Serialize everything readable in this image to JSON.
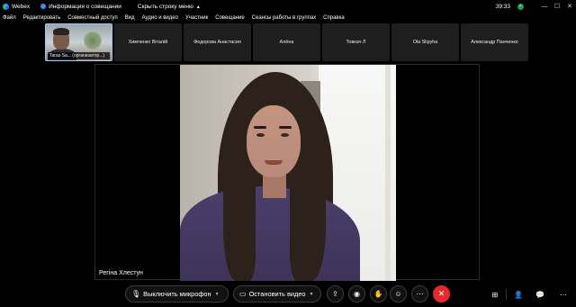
{
  "titlebar": {
    "app_name": "Webex",
    "meeting_info": "Информация о совещании",
    "hide_menu": "Скрыть строку меню",
    "time": "39:33"
  },
  "menu": [
    "Файл",
    "Редактировать",
    "Совместный доступ",
    "Вид",
    "Аудио и видео",
    "Участник",
    "Совещание",
    "Сеансы работы в группах",
    "Справка"
  ],
  "participants": [
    {
      "label": "Taras Sa... (организатор...)",
      "active": true
    },
    {
      "label": "Химченко Віталій"
    },
    {
      "label": "Федорова Анастасия"
    },
    {
      "label": "Алёна"
    },
    {
      "label": "Товкач Л"
    },
    {
      "label": "Ola Slipyha"
    },
    {
      "label": "Александр Панченко"
    }
  ],
  "stage": {
    "speaker_name": "Регіна Хлестун"
  },
  "controls": {
    "mute_label": "Выключить микрофон",
    "video_label": "Остановить видео"
  },
  "icons": {
    "mic": "microphone-icon",
    "video": "video-camera-icon",
    "share": "share-screen-icon",
    "record": "record-icon",
    "raise_hand": "raise-hand-icon",
    "reactions": "reactions-icon",
    "more": "more-icon",
    "end": "end-call-icon",
    "apps": "apps-icon",
    "participants_panel": "participants-panel-icon",
    "chat": "chat-icon"
  }
}
